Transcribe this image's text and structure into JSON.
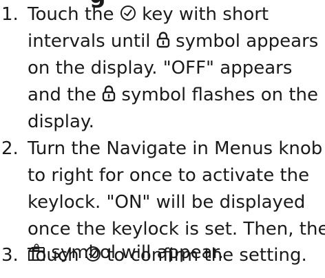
{
  "heading_fragment": "g",
  "steps": [
    {
      "number": "1.",
      "lines": [
        {
          "before": "Touch the",
          "icon": "clock-icon",
          "after": "key with short"
        },
        {
          "before": "intervals until",
          "icon": "lock-icon",
          "after": "symbol appears"
        },
        {
          "text": "on the display. \"OFF\" appears"
        },
        {
          "before": "and the",
          "icon": "lock-icon",
          "after": "symbol flashes on the"
        },
        {
          "text": "display."
        }
      ]
    },
    {
      "number": "2.",
      "lines": [
        {
          "text": "Turn the Navigate in Menus knob"
        },
        {
          "text": "to right for once to activate the"
        },
        {
          "text": "keylock. \"ON\" will be displayed"
        },
        {
          "text": "once the keylock is set. Then, the"
        },
        {
          "before": "",
          "icon": "keylock-display-icon",
          "after": "symbol will appear."
        }
      ]
    },
    {
      "number": "3.",
      "lines": [
        {
          "before": "Touch",
          "icon": "clock-icon",
          "after": "to confirm the setting."
        }
      ]
    }
  ]
}
